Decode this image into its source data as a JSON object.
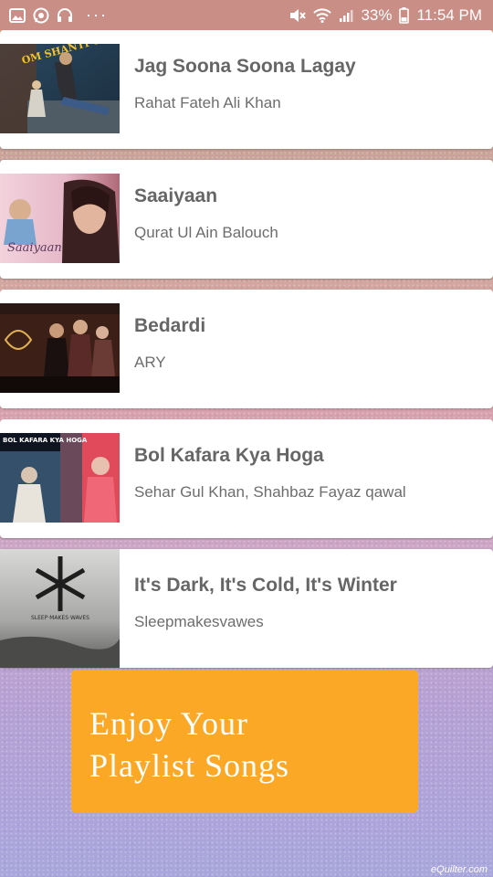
{
  "status_bar": {
    "battery": "33%",
    "time": "11:54 PM",
    "left_icons": [
      "gallery-icon",
      "whatsapp-icon",
      "headset-icon",
      "more-dots-icon"
    ],
    "right_icons": [
      "mute-icon",
      "wifi-icon",
      "signal-icon",
      "battery-icon"
    ],
    "dots": "···"
  },
  "songs": [
    {
      "title": "Jag Soona Soona Lagay",
      "artist": "Rahat Fateh Ali Khan",
      "thumb_label": "OM SHANTI OM"
    },
    {
      "title": "Saaiyaan",
      "artist": "Qurat Ul Ain Balouch",
      "thumb_label": "Saaiyaan"
    },
    {
      "title": "Bedardi",
      "artist": "ARY",
      "thumb_label": ""
    },
    {
      "title": "Bol Kafara Kya Hoga",
      "artist": "Sehar Gul Khan, Shahbaz Fayaz qawal",
      "thumb_label": "BOL KAFARA KYA HOGA"
    },
    {
      "title": "It's Dark, It's Cold, It's Winter",
      "artist": "Sleepmakesvawes",
      "thumb_label": "SLEEP·MAKES·WAVES"
    }
  ],
  "banner": {
    "text": "Enjoy Your\nPlaylist Songs",
    "color": "#fba826"
  },
  "watermark": "eQuilter.com"
}
